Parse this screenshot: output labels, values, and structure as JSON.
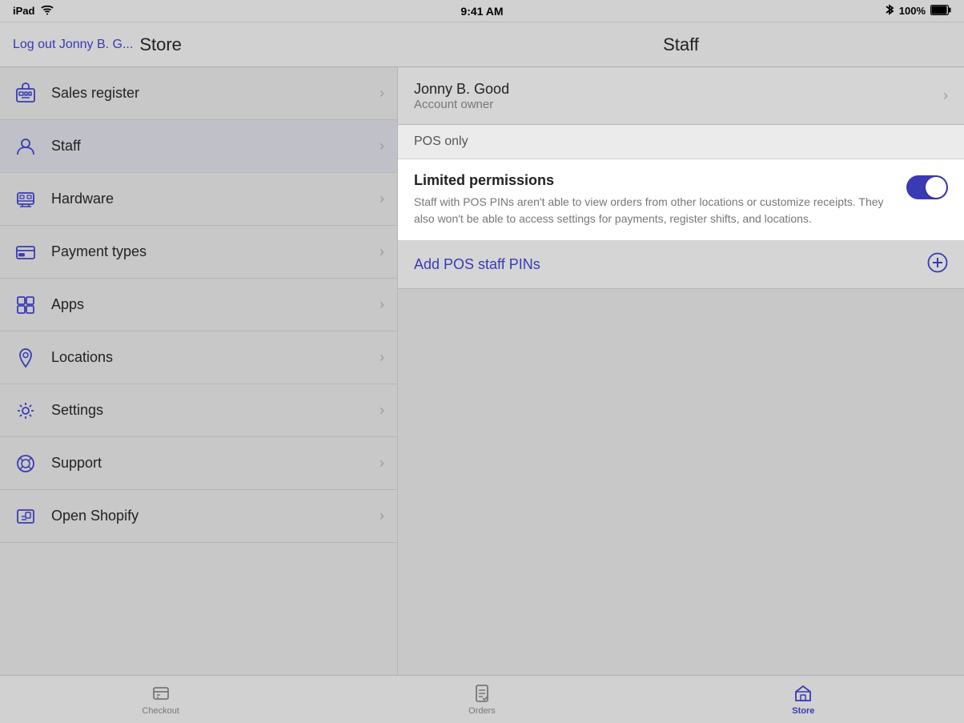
{
  "statusBar": {
    "device": "iPad",
    "wifi": "wifi",
    "time": "9:41 AM",
    "bluetooth": "bluetooth",
    "battery": "100%"
  },
  "header": {
    "logoutText": "Log out Jonny B. G...",
    "storeTitle": "Store",
    "staffTitle": "Staff"
  },
  "sidebar": {
    "items": [
      {
        "id": "sales-register",
        "label": "Sales register",
        "icon": "register"
      },
      {
        "id": "staff",
        "label": "Staff",
        "icon": "staff"
      },
      {
        "id": "hardware",
        "label": "Hardware",
        "icon": "hardware"
      },
      {
        "id": "payment-types",
        "label": "Payment types",
        "icon": "payment"
      },
      {
        "id": "apps",
        "label": "Apps",
        "icon": "apps"
      },
      {
        "id": "locations",
        "label": "Locations",
        "icon": "location"
      },
      {
        "id": "settings",
        "label": "Settings",
        "icon": "settings"
      },
      {
        "id": "support",
        "label": "Support",
        "icon": "support"
      },
      {
        "id": "open-shopify",
        "label": "Open Shopify",
        "icon": "shopify"
      }
    ]
  },
  "staffPanel": {
    "personName": "Jonny B. Good",
    "personRole": "Account owner",
    "posOnlyLabel": "POS only",
    "limitedPermsTitle": "Limited permissions",
    "limitedPermsDesc": "Staff with POS PINs aren't able to view orders from other locations or customize receipts. They also won't be able to access settings for payments, register shifts, and locations.",
    "toggleOn": true,
    "addPinsLabel": "Add POS staff PINs"
  },
  "tabBar": {
    "tabs": [
      {
        "id": "checkout",
        "label": "Checkout",
        "active": false
      },
      {
        "id": "orders",
        "label": "Orders",
        "active": false
      },
      {
        "id": "store",
        "label": "Store",
        "active": true
      }
    ]
  }
}
